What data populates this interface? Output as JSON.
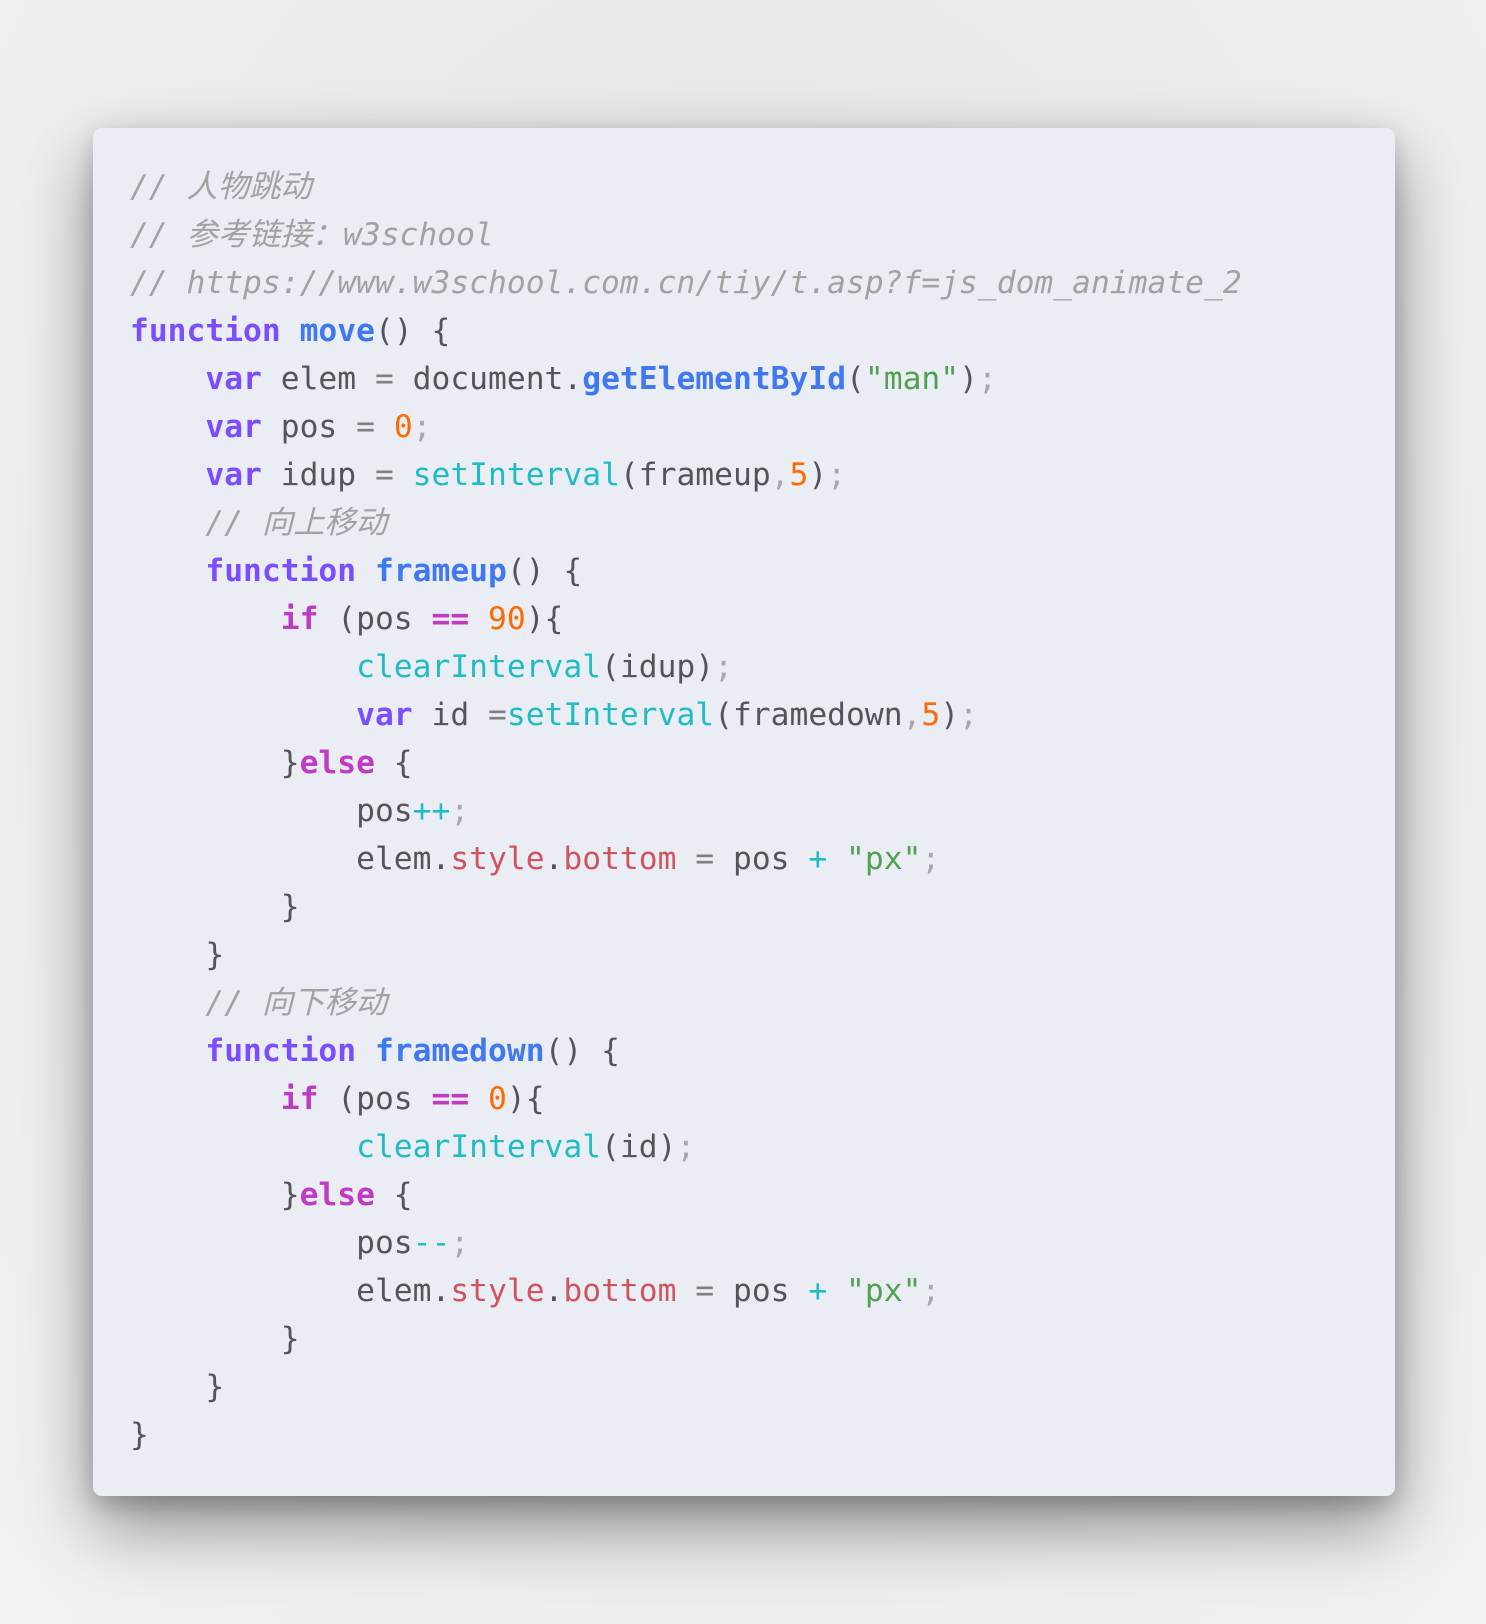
{
  "code_block": {
    "language": "javascript",
    "colors": {
      "background": "#eaedf4",
      "comment": "#a2a2a2",
      "keyword": "#7c4dff",
      "control": "#c03bc4",
      "function_name": "#4078f2",
      "builtin": "#1fbcc6",
      "string": "#50a14f",
      "number": "#ff6a00",
      "property": "#d0545f",
      "text": "#555559"
    },
    "lines": [
      [
        [
          "comment",
          "// 人物跳动"
        ]
      ],
      [
        [
          "comment",
          "// 参考链接：w3school"
        ]
      ],
      [
        [
          "comment",
          "// https://www.w3school.com.cn/tiy/t.asp?f=js_dom_animate_2"
        ]
      ],
      [
        [
          "keyword",
          "function"
        ],
        [
          "text",
          " "
        ],
        [
          "func",
          "move"
        ],
        [
          "text",
          "() {"
        ]
      ],
      [
        [
          "text",
          "    "
        ],
        [
          "keyword",
          "var"
        ],
        [
          "text",
          " elem "
        ],
        [
          "op",
          "="
        ],
        [
          "text",
          " document."
        ],
        [
          "func",
          "getElementById"
        ],
        [
          "text",
          "("
        ],
        [
          "string",
          "\"man\""
        ],
        [
          "text",
          ")"
        ],
        [
          "punct",
          ";"
        ]
      ],
      [
        [
          "text",
          "    "
        ],
        [
          "keyword",
          "var"
        ],
        [
          "text",
          " pos "
        ],
        [
          "op",
          "="
        ],
        [
          "text",
          " "
        ],
        [
          "number",
          "0"
        ],
        [
          "punct",
          ";"
        ]
      ],
      [
        [
          "text",
          "    "
        ],
        [
          "keyword",
          "var"
        ],
        [
          "text",
          " idup "
        ],
        [
          "op",
          "="
        ],
        [
          "text",
          " "
        ],
        [
          "builtin",
          "setInterval"
        ],
        [
          "text",
          "(frameup"
        ],
        [
          "punct",
          ","
        ],
        [
          "number",
          "5"
        ],
        [
          "text",
          ")"
        ],
        [
          "punct",
          ";"
        ]
      ],
      [
        [
          "text",
          "    "
        ],
        [
          "comment",
          "// 向上移动"
        ]
      ],
      [
        [
          "text",
          "    "
        ],
        [
          "keyword",
          "function"
        ],
        [
          "text",
          " "
        ],
        [
          "func",
          "frameup"
        ],
        [
          "text",
          "() {"
        ]
      ],
      [
        [
          "text",
          "        "
        ],
        [
          "control",
          "if"
        ],
        [
          "text",
          " (pos "
        ],
        [
          "opc",
          "=="
        ],
        [
          "text",
          " "
        ],
        [
          "number",
          "90"
        ],
        [
          "text",
          "){"
        ]
      ],
      [
        [
          "text",
          "            "
        ],
        [
          "builtin",
          "clearInterval"
        ],
        [
          "text",
          "(idup)"
        ],
        [
          "punct",
          ";"
        ]
      ],
      [
        [
          "text",
          "            "
        ],
        [
          "keyword",
          "var"
        ],
        [
          "text",
          " id "
        ],
        [
          "op",
          "="
        ],
        [
          "builtin",
          "setInterval"
        ],
        [
          "text",
          "(framedown"
        ],
        [
          "punct",
          ","
        ],
        [
          "number",
          "5"
        ],
        [
          "text",
          ")"
        ],
        [
          "punct",
          ";"
        ]
      ],
      [
        [
          "text",
          "        }"
        ],
        [
          "control",
          "else"
        ],
        [
          "text",
          " {"
        ]
      ],
      [
        [
          "text",
          "            pos"
        ],
        [
          "opt",
          "++"
        ],
        [
          "punct",
          ";"
        ]
      ],
      [
        [
          "text",
          "            elem."
        ],
        [
          "prop",
          "style"
        ],
        [
          "text",
          "."
        ],
        [
          "prop",
          "bottom"
        ],
        [
          "text",
          " "
        ],
        [
          "op",
          "="
        ],
        [
          "text",
          " pos "
        ],
        [
          "opt",
          "+"
        ],
        [
          "text",
          " "
        ],
        [
          "string",
          "\"px\""
        ],
        [
          "punct",
          ";"
        ]
      ],
      [
        [
          "text",
          "        }"
        ]
      ],
      [
        [
          "text",
          "    }"
        ]
      ],
      [
        [
          "text",
          "    "
        ],
        [
          "comment",
          "// 向下移动"
        ]
      ],
      [
        [
          "text",
          "    "
        ],
        [
          "keyword",
          "function"
        ],
        [
          "text",
          " "
        ],
        [
          "func",
          "framedown"
        ],
        [
          "text",
          "() {"
        ]
      ],
      [
        [
          "text",
          "        "
        ],
        [
          "control",
          "if"
        ],
        [
          "text",
          " (pos "
        ],
        [
          "opc",
          "=="
        ],
        [
          "text",
          " "
        ],
        [
          "number",
          "0"
        ],
        [
          "text",
          "){"
        ]
      ],
      [
        [
          "text",
          "            "
        ],
        [
          "builtin",
          "clearInterval"
        ],
        [
          "text",
          "(id)"
        ],
        [
          "punct",
          ";"
        ]
      ],
      [
        [
          "text",
          "        }"
        ],
        [
          "control",
          "else"
        ],
        [
          "text",
          " {"
        ]
      ],
      [
        [
          "text",
          "            pos"
        ],
        [
          "opt",
          "--"
        ],
        [
          "punct",
          ";"
        ]
      ],
      [
        [
          "text",
          "            elem."
        ],
        [
          "prop",
          "style"
        ],
        [
          "text",
          "."
        ],
        [
          "prop",
          "bottom"
        ],
        [
          "text",
          " "
        ],
        [
          "op",
          "="
        ],
        [
          "text",
          " pos "
        ],
        [
          "opt",
          "+"
        ],
        [
          "text",
          " "
        ],
        [
          "string",
          "\"px\""
        ],
        [
          "punct",
          ";"
        ]
      ],
      [
        [
          "text",
          "        }"
        ]
      ],
      [
        [
          "text",
          "    }"
        ]
      ],
      [
        [
          "text",
          "}"
        ]
      ]
    ]
  }
}
